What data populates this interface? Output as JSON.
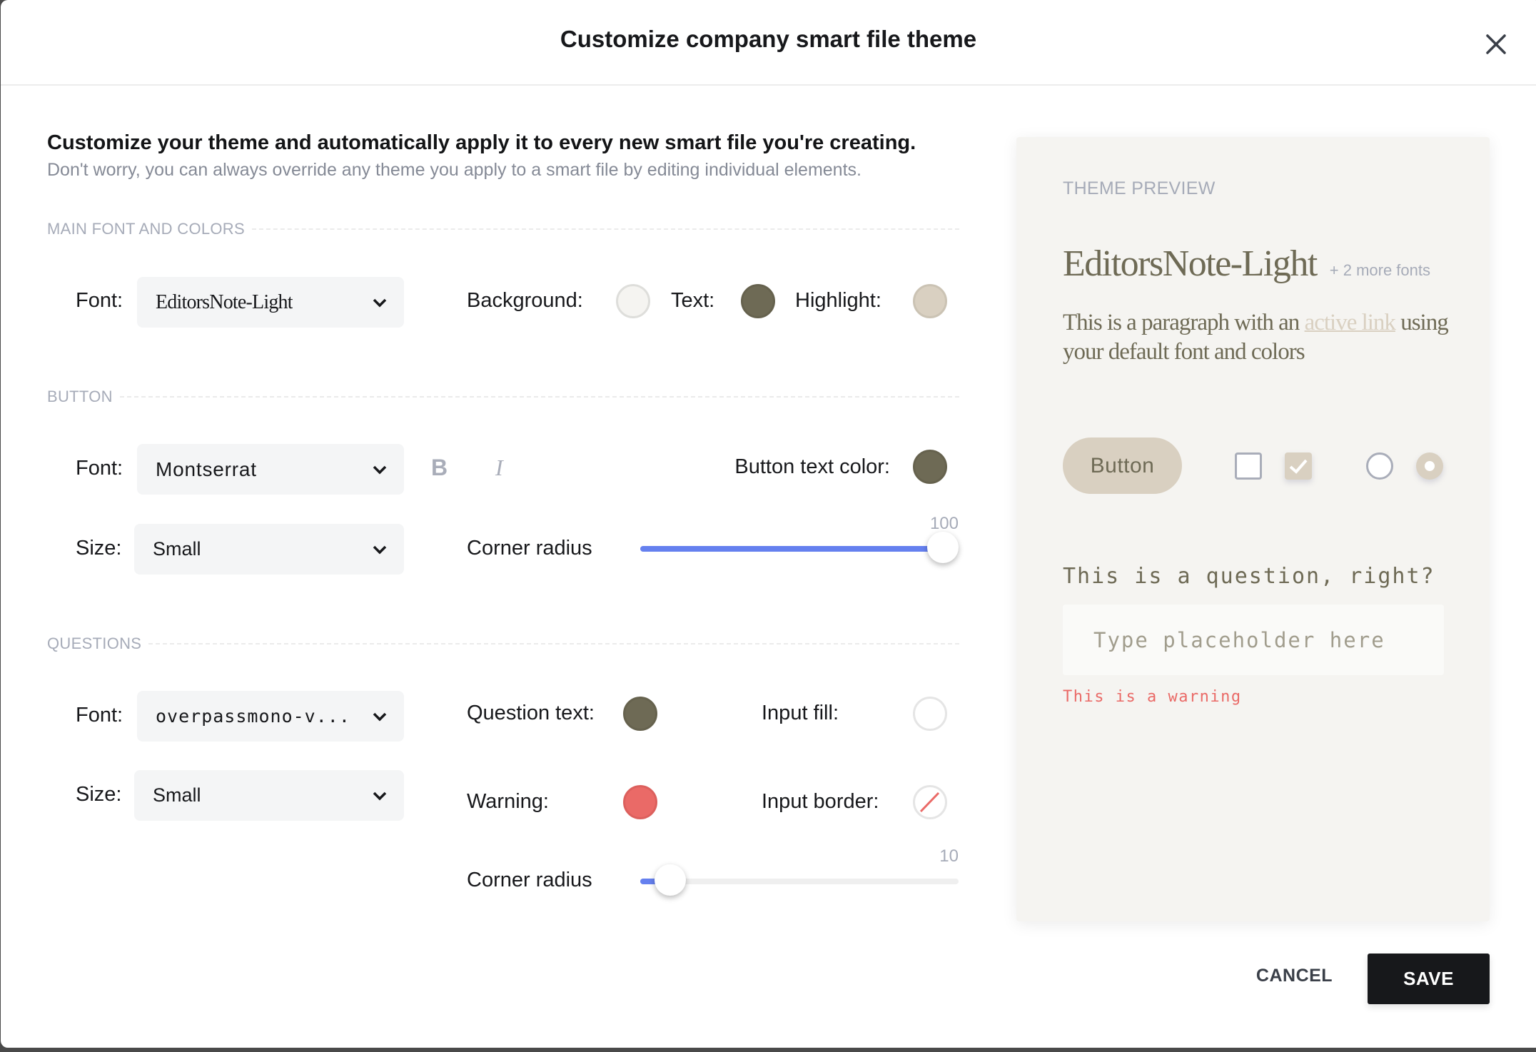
{
  "dialog": {
    "title": "Customize company smart file theme",
    "close_icon": "close-x-icon"
  },
  "intro": {
    "heading": "Customize your theme and automatically apply it to every new smart file you're creating.",
    "subtext": "Don't worry, you can always override any theme you apply to a smart file by editing individual elements."
  },
  "main": {
    "section_title": "MAIN FONT AND COLORS",
    "font_label": "Font:",
    "font_value": "EditorsNote-Light",
    "background_label": "Background:",
    "background_color": "#f5f4f1",
    "text_label": "Text:",
    "text_color": "#6e6a55",
    "highlight_label": "Highlight:",
    "highlight_color": "#d9d0c1"
  },
  "button": {
    "section_title": "BUTTON",
    "font_label": "Font:",
    "font_value": "Montserrat",
    "bold_label": "B",
    "italic_label": "I",
    "text_color_label": "Button text color:",
    "text_color": "#6e6a55",
    "size_label": "Size:",
    "size_value": "Small",
    "corner_radius_label": "Corner radius",
    "corner_radius_value": 100,
    "corner_radius_max": 100,
    "corner_radius_display": "100"
  },
  "questions": {
    "section_title": "QUESTIONS",
    "font_label": "Font:",
    "font_value": "overpassmono-v...",
    "size_label": "Size:",
    "size_value": "Small",
    "question_text_label": "Question text:",
    "question_text_color": "#6e6a55",
    "input_fill_label": "Input fill:",
    "input_fill_color": "#ffffff",
    "warning_label": "Warning:",
    "warning_color": "#ea6a67",
    "input_border_label": "Input border:",
    "input_border_color": "none",
    "corner_radius_label": "Corner radius",
    "corner_radius_value": 10,
    "corner_radius_max": 100,
    "corner_radius_display": "10"
  },
  "preview": {
    "label": "THEME PREVIEW",
    "heading": "EditorsNote-Light",
    "more_fonts": "+ 2 more fonts",
    "paragraph_before": "This is a paragraph with an ",
    "paragraph_link": "active link",
    "paragraph_after": " using your default font and colors",
    "button_label": "Button",
    "checkbox_unchecked": false,
    "checkbox_checked": true,
    "radio_unselected": false,
    "radio_selected": true,
    "question": "This is a question, right?",
    "input_placeholder": "Type placeholder here",
    "warning": "This is a warning"
  },
  "footer": {
    "cancel_label": "CANCEL",
    "save_label": "SAVE"
  },
  "colors": {
    "accent": "#6580ef",
    "primary_button": "#17181b"
  }
}
